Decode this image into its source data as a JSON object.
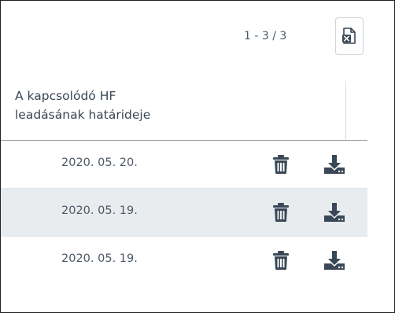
{
  "pager": {
    "text": "1 - 3 / 3"
  },
  "export": {
    "icon": "excel-export-icon"
  },
  "table": {
    "column_header": "A kapcsolódó HF leadásának határideje",
    "column_header_lines": [
      "A kapcsolódó HF",
      "leadásának határideje"
    ],
    "rows": [
      {
        "date": "2020. 05. 20."
      },
      {
        "date": "2020. 05. 19."
      },
      {
        "date": "2020. 05. 19."
      }
    ]
  },
  "colors": {
    "icon": "#3a4756",
    "row_alt_background": "#e9ecef",
    "border": "#202020"
  }
}
